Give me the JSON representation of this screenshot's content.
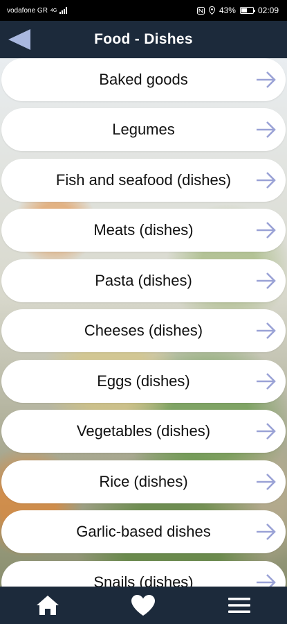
{
  "status_bar": {
    "carrier": "vodafone GR",
    "network": "4G",
    "battery": "43%",
    "time": "02:09",
    "icons": [
      "signal-icon",
      "nfc-icon",
      "location-icon",
      "battery-icon"
    ]
  },
  "header": {
    "title": "Food - Dishes",
    "back_icon": "back-arrow-icon"
  },
  "list": {
    "items": [
      {
        "label": "Baked goods"
      },
      {
        "label": "Legumes"
      },
      {
        "label": "Fish and seafood (dishes)"
      },
      {
        "label": "Meats (dishes)"
      },
      {
        "label": "Pasta (dishes)"
      },
      {
        "label": "Cheeses (dishes)"
      },
      {
        "label": "Eggs (dishes)"
      },
      {
        "label": "Vegetables (dishes)"
      },
      {
        "label": "Rice (dishes)"
      },
      {
        "label": "Garlic-based dishes"
      },
      {
        "label": "Snails (dishes)"
      }
    ],
    "item_icon": "arrow-right-icon"
  },
  "bottom_nav": {
    "items": [
      "home-icon",
      "heart-icon",
      "menu-icon"
    ]
  },
  "colors": {
    "bar_background": "#1c2a3b",
    "arrow_accent": "#9aa2d6",
    "back_arrow": "#a9b8e0"
  }
}
